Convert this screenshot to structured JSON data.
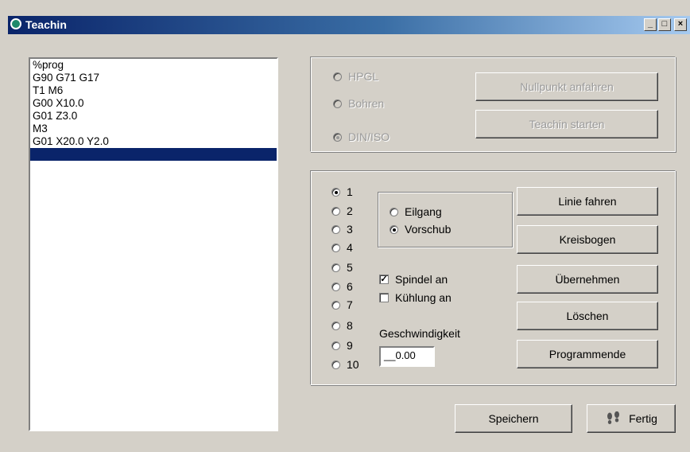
{
  "window": {
    "title": "Teachin",
    "minimize": "_",
    "maximize": "□",
    "close": "×"
  },
  "program": {
    "lines": [
      "%prog",
      "G90 G71 G17",
      "T1 M6",
      "G00 X10.0",
      "G01 Z3.0",
      "M3",
      "G01 X20.0 Y2.0",
      ""
    ],
    "selected_index": 7
  },
  "mode_group": {
    "options": [
      "HPGL",
      "Bohren",
      "DIN/ISO"
    ],
    "selected": "DIN/ISO",
    "disabled": true,
    "buttons": {
      "nullpunkt": "Nullpunkt anfahren",
      "teachin": "Teachin starten"
    }
  },
  "tool_numbers": [
    "1",
    "2",
    "3",
    "4",
    "5",
    "6",
    "7",
    "8",
    "9",
    "10"
  ],
  "tool_selected": "1",
  "speed_mode": {
    "options": [
      "Eilgang",
      "Vorschub"
    ],
    "selected": "Vorschub"
  },
  "spindel": {
    "label": "Spindel an",
    "checked": true
  },
  "kuehlung": {
    "label": "Kühlung an",
    "checked": false
  },
  "geschwindigkeit": {
    "label": "Geschwindigkeit",
    "value": "__0.00"
  },
  "actions": [
    "Linie fahren",
    "Kreisbogen",
    "Übernehmen",
    "Löschen",
    "Programmende"
  ],
  "footer": {
    "save": "Speichern",
    "done": "Fertig"
  }
}
